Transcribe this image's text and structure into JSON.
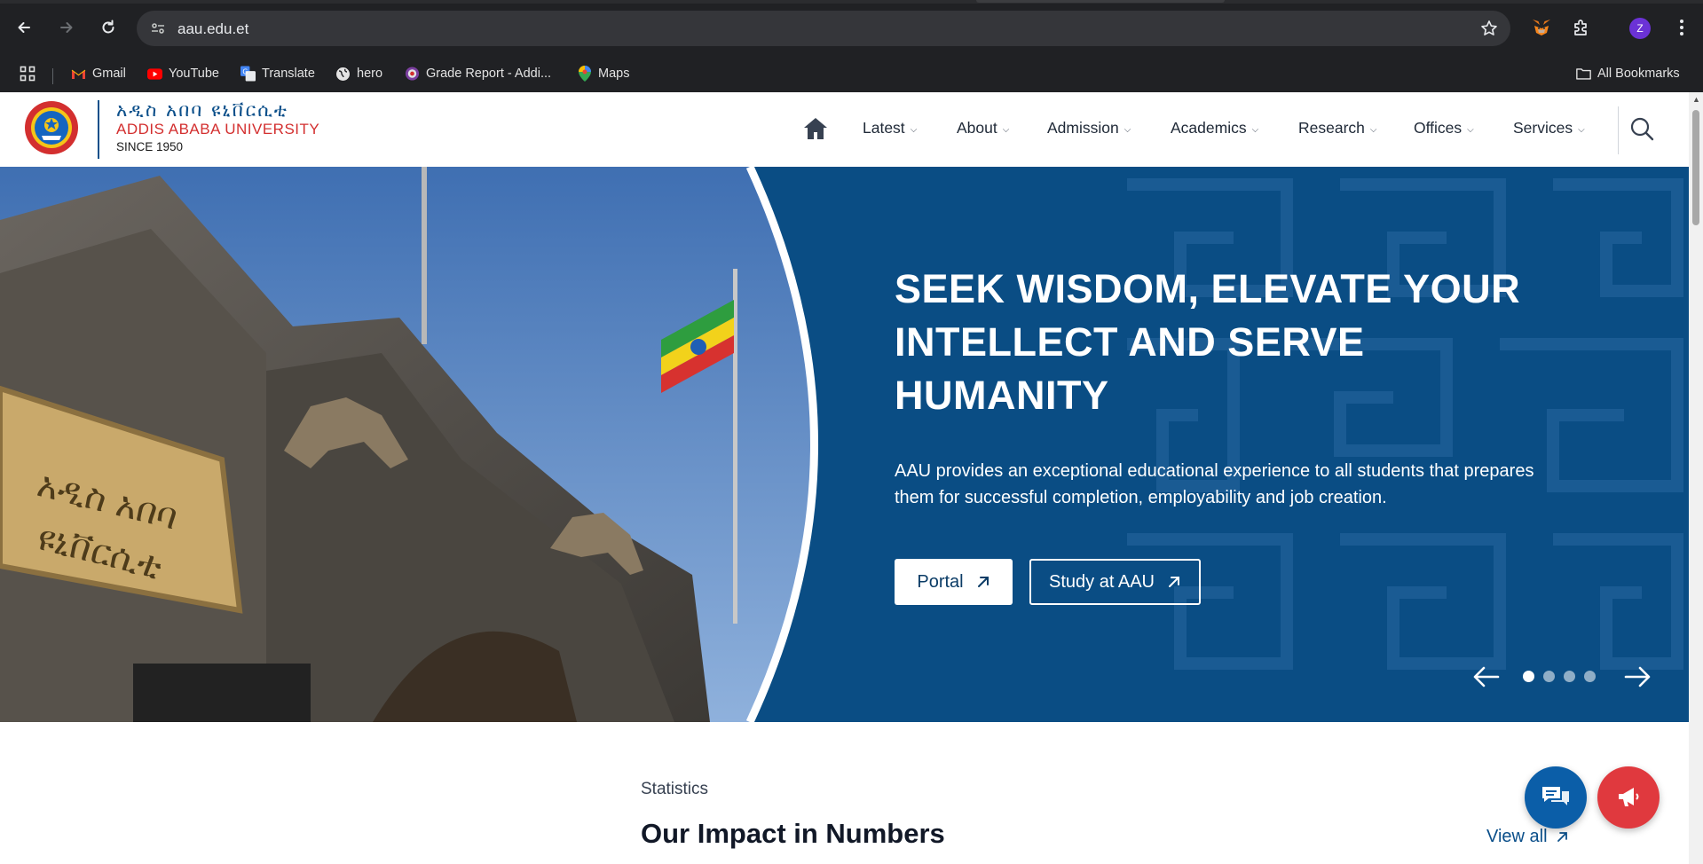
{
  "browser": {
    "url": "aau.edu.et",
    "profile_initial": "Z",
    "bookmarks": [
      {
        "label": "Gmail",
        "icon": "gmail-icon"
      },
      {
        "label": "YouTube",
        "icon": "youtube-icon"
      },
      {
        "label": "Translate",
        "icon": "translate-icon"
      },
      {
        "label": "hero",
        "icon": "globe-icon"
      },
      {
        "label": "Grade Report - Addi...",
        "icon": "seal-icon"
      },
      {
        "label": "Maps",
        "icon": "maps-icon"
      }
    ],
    "all_bookmarks_label": "All Bookmarks"
  },
  "site": {
    "logo_amharic": "አዲስ አበባ ዩኒቨርሲቲ",
    "logo_english": "ADDIS ABABA UNIVERSITY",
    "logo_since": "SINCE 1950",
    "menu": [
      "Latest",
      "About",
      "Admission",
      "Academics",
      "Research",
      "Offices",
      "Services"
    ]
  },
  "hero": {
    "title": "SEEK WISDOM, ELEVATE YOUR INTELLECT AND SERVE HUMANITY",
    "subtitle": "AAU provides an exceptional educational experience to all students that prepares them for successful completion, employability and job creation.",
    "primary_button": "Portal",
    "secondary_button": "Study at AAU",
    "slide_count": 4,
    "active_slide": 1
  },
  "statistics": {
    "label": "Statistics",
    "title": "Our Impact in Numbers",
    "view_all": "View all"
  },
  "colors": {
    "hero_bg": "#0a4d84",
    "brand_blue": "#0b4f8a",
    "brand_red": "#d32f2f",
    "chat_fab": "#0b5ea8",
    "announce_fab": "#e0393e"
  }
}
